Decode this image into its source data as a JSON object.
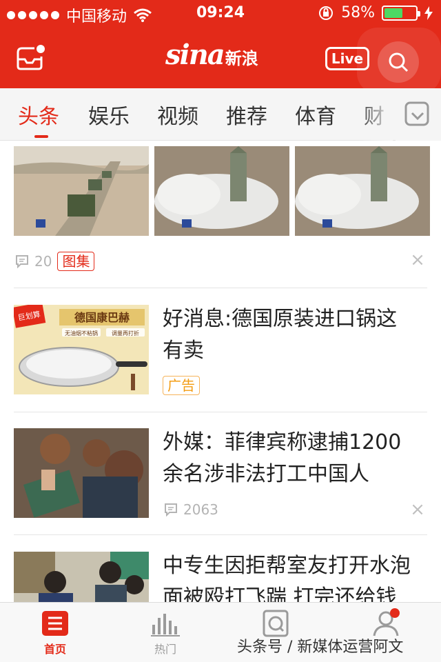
{
  "status_bar": {
    "carrier": "中国移动",
    "time": "09:24",
    "battery_percent": "58%",
    "battery_level": 0.58
  },
  "header": {
    "logo_text": "sina",
    "logo_cn": "新浪",
    "live_label": "Live",
    "inbox_icon": "inbox-icon",
    "search_icon": "search-icon",
    "brand_color": "#e32a19"
  },
  "tabs": {
    "items": [
      "头条",
      "娱乐",
      "视频",
      "推荐",
      "体育",
      "财"
    ],
    "active_index": 0
  },
  "feed": {
    "gallery": {
      "comment_count": "20",
      "tag": "图集",
      "close_icon": "close-icon"
    },
    "items": [
      {
        "title_line1": "好消息:德国原装进口锅这",
        "title_line2": "有卖",
        "tag": "广告",
        "ad_banner_text": "德国康巴赫",
        "ad_corner": "巨划算",
        "ad_sub1": "无油烟不粘锅",
        "ad_sub2": "调量再打折"
      },
      {
        "title_line1": "外媒：菲律宾称逮捕1200",
        "title_line2": "余名涉非法打工中国人",
        "comment_count": "2063",
        "close_icon": "close-icon"
      },
      {
        "title_line1": "中专生因拒帮室友打开水泡",
        "title_line2": "面被殴打飞踹 打完还给钱"
      }
    ]
  },
  "bottom_nav": {
    "items": [
      {
        "label": "首页",
        "icon": "home-icon"
      },
      {
        "label": "热门",
        "icon": "chart-icon"
      },
      {
        "label": "",
        "icon": "discover-icon"
      },
      {
        "label": "",
        "icon": "profile-icon"
      }
    ],
    "watermark": "头条号 / 新媒体运营阿文"
  }
}
